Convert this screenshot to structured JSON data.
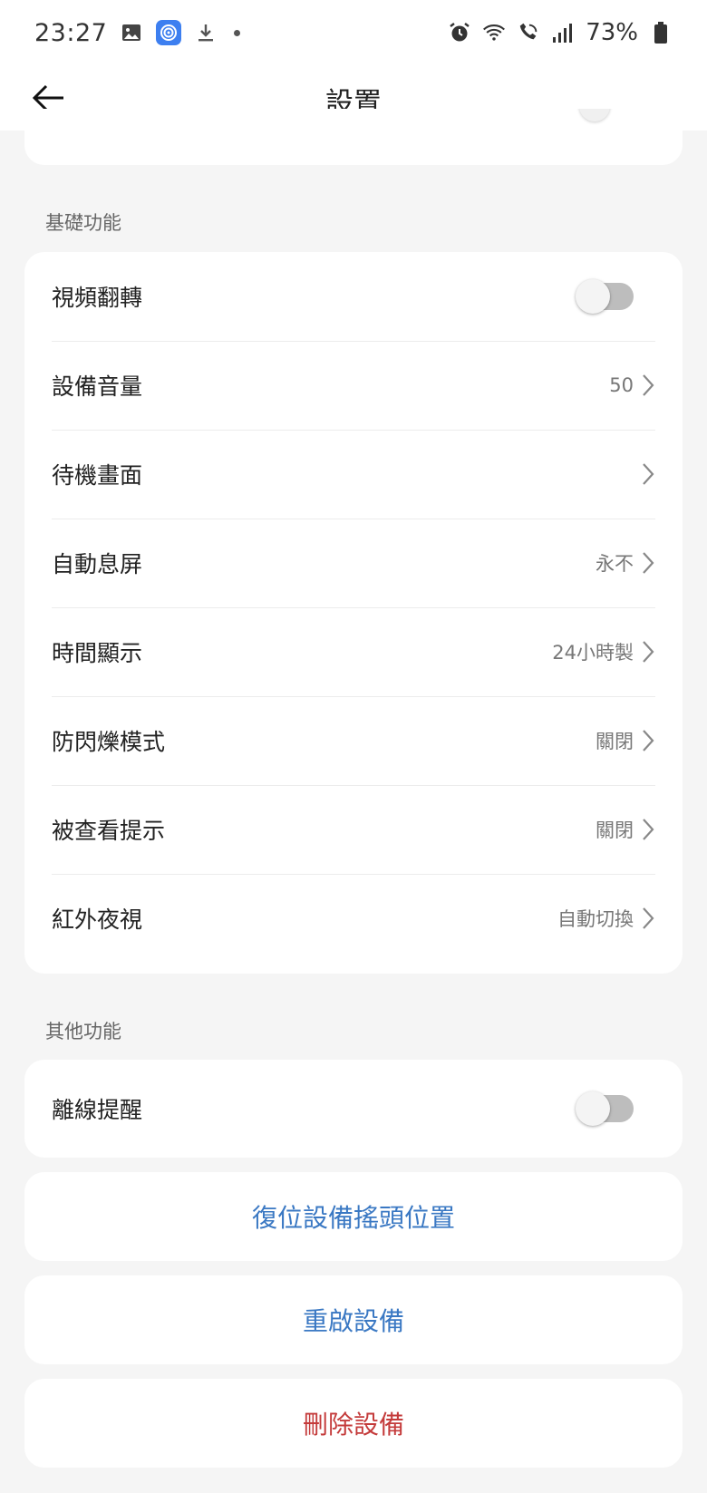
{
  "status_bar": {
    "time": "23:27",
    "battery": "73%",
    "left_icons": [
      "gallery-icon",
      "app-icon",
      "download-icon",
      "dot-icon"
    ],
    "right_icons": [
      "alarm-icon",
      "wifi-icon",
      "wifi-call-icon",
      "signal-icon",
      "battery-icon"
    ]
  },
  "header": {
    "title": "設置",
    "back_icon": "arrow-left-icon"
  },
  "sections": {
    "basic": {
      "title": "基礎功能",
      "rows": [
        {
          "label": "視頻翻轉",
          "type": "toggle",
          "on": false
        },
        {
          "label": "設備音量",
          "value": "50"
        },
        {
          "label": "待機畫面",
          "value": ""
        },
        {
          "label": "自動息屏",
          "value": "永不"
        },
        {
          "label": "時間顯示",
          "value": "24小時製"
        },
        {
          "label": "防閃爍模式",
          "value": "關閉"
        },
        {
          "label": "被查看提示",
          "value": "關閉"
        },
        {
          "label": "紅外夜視",
          "value": "自動切換"
        }
      ]
    },
    "other": {
      "title": "其他功能",
      "rows": [
        {
          "label": "離線提醒",
          "type": "toggle",
          "on": false
        }
      ]
    }
  },
  "actions": {
    "reset_pan": "復位設備搖頭位置",
    "reboot": "重啟設備",
    "delete": "刪除設備"
  },
  "colors": {
    "action_blue": "#3a78c3",
    "delete_red": "#c43b3b",
    "background": "#f5f5f5"
  }
}
